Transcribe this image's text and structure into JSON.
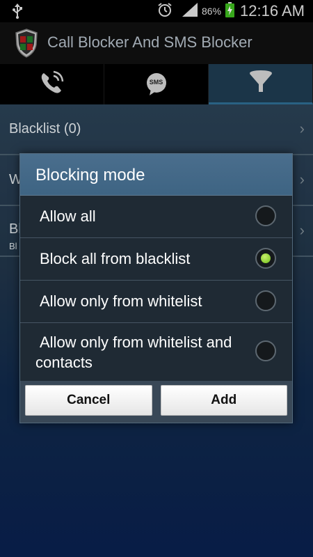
{
  "status_bar": {
    "battery_percent": "86%",
    "time": "12:16 AM",
    "icons": [
      "usb-icon",
      "alarm-icon",
      "signal-icon",
      "battery-charging-icon"
    ]
  },
  "app": {
    "title": "Call Blocker And SMS Blocker"
  },
  "tabs": [
    {
      "icon": "phone-icon",
      "active": false
    },
    {
      "icon": "sms-icon",
      "label": "SMS",
      "active": false
    },
    {
      "icon": "filter-icon",
      "active": true
    }
  ],
  "list": {
    "items": [
      {
        "label": "Blacklist (0)"
      },
      {
        "label": "W"
      },
      {
        "label": "Bl",
        "sub": "Bl"
      }
    ]
  },
  "dialog": {
    "title": "Blocking mode",
    "options": [
      {
        "label": "Allow all",
        "checked": false
      },
      {
        "label": "Block all from blacklist",
        "checked": true
      },
      {
        "label": "Allow only from whitelist",
        "checked": false
      },
      {
        "label": "Allow only from whitelist and contacts",
        "checked": false
      }
    ],
    "cancel_label": "Cancel",
    "add_label": "Add"
  },
  "colors": {
    "accent": "#3e6483",
    "radio_checked": "#7fd02a"
  }
}
